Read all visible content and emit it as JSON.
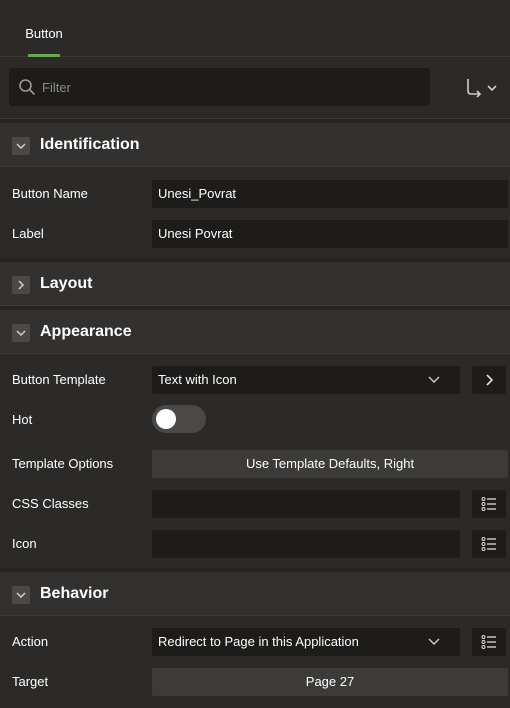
{
  "tabs": [
    {
      "label": "Button"
    }
  ],
  "filter": {
    "placeholder": "Filter"
  },
  "sections": {
    "identification": {
      "title": "Identification",
      "expanded": true,
      "button_name": {
        "label": "Button Name",
        "value": "Unesi_Povrat"
      },
      "label": {
        "label": "Label",
        "value": "Unesi Povrat"
      }
    },
    "layout": {
      "title": "Layout",
      "expanded": false
    },
    "appearance": {
      "title": "Appearance",
      "expanded": true,
      "button_template": {
        "label": "Button Template",
        "value": "Text with Icon"
      },
      "hot": {
        "label": "Hot",
        "checked": false
      },
      "template_options": {
        "label": "Template Options",
        "value": "Use Template Defaults, Right"
      },
      "css_classes": {
        "label": "CSS Classes",
        "value": ""
      },
      "icon": {
        "label": "Icon",
        "value": ""
      }
    },
    "behavior": {
      "title": "Behavior",
      "expanded": true,
      "action": {
        "label": "Action",
        "value": "Redirect to Page in this Application"
      },
      "target": {
        "label": "Target",
        "value": "Page 27"
      }
    }
  },
  "colors": {
    "background": "#2b2a28",
    "field": "#1d1c1a",
    "tab_underline": "#6aa84f",
    "section_header": "#32312f"
  }
}
